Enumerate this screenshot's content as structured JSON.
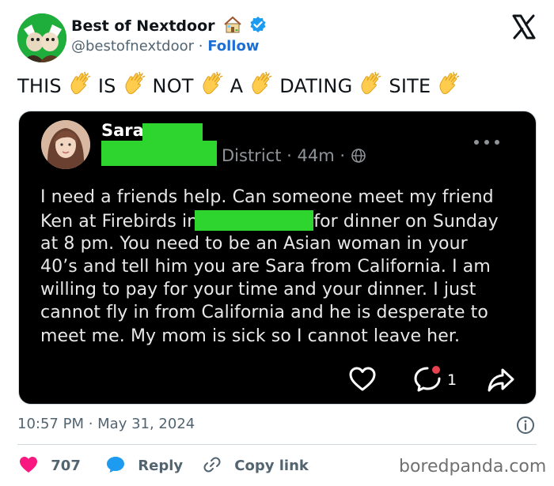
{
  "tweet": {
    "display_name": "Best of Nextdoor",
    "handle": "@bestofnextdoor",
    "separator": " · ",
    "follow_label": "Follow",
    "text_words": [
      "THIS",
      "IS",
      "NOT",
      "A",
      "DATING",
      "SITE"
    ],
    "timestamp": "10:57 PM · May 31, 2024",
    "likes": "707",
    "reply_label": "Reply",
    "copy_link_label": "Copy link"
  },
  "post": {
    "author_name": "Sara",
    "location_suffix": "District",
    "time_ago": "44m",
    "meta_sep": " · ",
    "line_1": "I need a friends help.  Can someone meet my friend",
    "line_2a": "Ken at Firebirds in",
    "line_2b": "for dinner on Sunday",
    "line_3": "at 8 pm.  You need to be an Asian woman in your",
    "line_4": "40’s and tell him you are Sara from California.  I am",
    "line_5": "willing to pay for your time and your dinner.  I just",
    "line_6": "cannot fly in from California and he is desperate to",
    "line_7": "meet me.  My mom is sick so I cannot leave her.",
    "comment_count": "1"
  },
  "watermark": "boredpanda.com",
  "colors": {
    "follow_blue": "#1d6fd3",
    "redaction_green": "#2fd52f",
    "like_pink": "#f91880",
    "reply_blue": "#1d9bf0",
    "card_bg": "#000000"
  },
  "icons": [
    "house-icon",
    "verified-badge-icon",
    "x-logo-icon",
    "clapping-hands-icon",
    "globe-icon",
    "more-dots-icon",
    "heart-outline-icon",
    "comment-icon",
    "share-arrow-icon",
    "info-icon",
    "heart-icon",
    "reply-bubble-icon",
    "link-icon"
  ]
}
